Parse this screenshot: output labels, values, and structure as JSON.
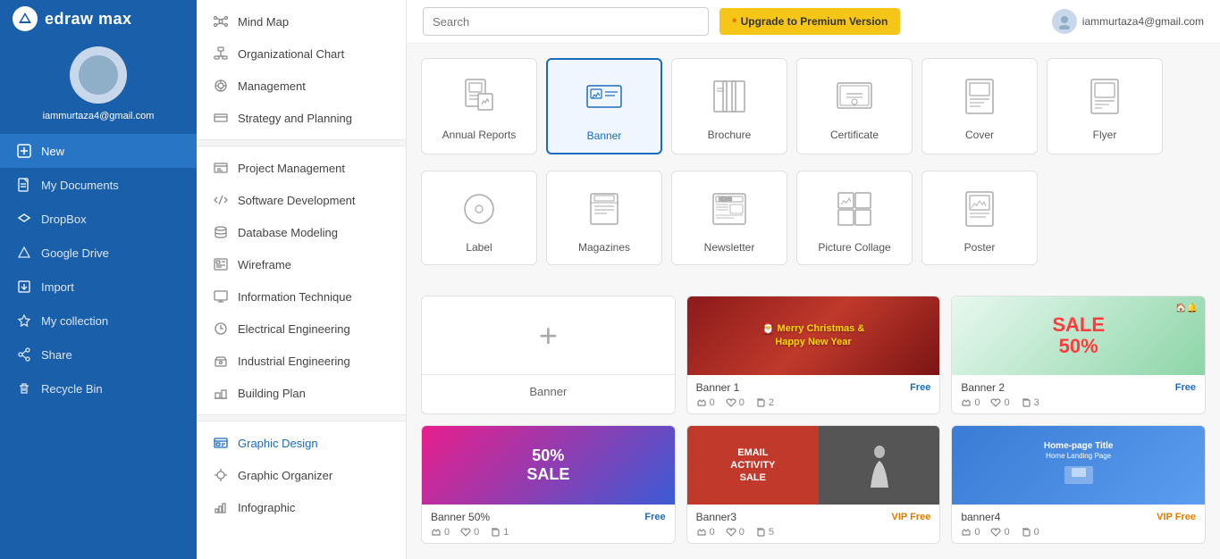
{
  "app": {
    "name": "edraw max"
  },
  "user": {
    "email": "iammurtaza4@gmail.com"
  },
  "topbar": {
    "search_placeholder": "Search",
    "upgrade_label": "Upgrade to Premium Version"
  },
  "sidebar_nav": [
    {
      "id": "new",
      "label": "New",
      "icon": "plus-square"
    },
    {
      "id": "my-documents",
      "label": "My Documents",
      "icon": "file"
    },
    {
      "id": "dropbox",
      "label": "DropBox",
      "icon": "dropbox"
    },
    {
      "id": "google-drive",
      "label": "Google Drive",
      "icon": "triangle"
    },
    {
      "id": "import",
      "label": "Import",
      "icon": "import"
    },
    {
      "id": "my-collection",
      "label": "My collection",
      "icon": "star"
    },
    {
      "id": "share",
      "label": "Share",
      "icon": "share"
    },
    {
      "id": "recycle-bin",
      "label": "Recycle Bin",
      "icon": "trash"
    }
  ],
  "categories": {
    "group1": [
      {
        "id": "mind-map",
        "label": "Mind Map"
      },
      {
        "id": "org-chart",
        "label": "Organizational Chart"
      },
      {
        "id": "management",
        "label": "Management"
      },
      {
        "id": "strategy",
        "label": "Strategy and Planning"
      }
    ],
    "group2": [
      {
        "id": "project-mgmt",
        "label": "Project Management"
      },
      {
        "id": "software-dev",
        "label": "Software Development"
      },
      {
        "id": "database",
        "label": "Database Modeling"
      },
      {
        "id": "wireframe",
        "label": "Wireframe"
      },
      {
        "id": "info-tech",
        "label": "Information Technique"
      },
      {
        "id": "electrical",
        "label": "Electrical Engineering"
      },
      {
        "id": "industrial",
        "label": "Industrial Engineering"
      },
      {
        "id": "building",
        "label": "Building Plan"
      }
    ],
    "group3": [
      {
        "id": "graphic-design",
        "label": "Graphic Design",
        "active": true
      },
      {
        "id": "graphic-organizer",
        "label": "Graphic Organizer"
      },
      {
        "id": "infographic",
        "label": "Infographic"
      }
    ]
  },
  "template_types": [
    {
      "id": "annual-reports",
      "label": "Annual Reports"
    },
    {
      "id": "banner",
      "label": "Banner",
      "selected": true
    },
    {
      "id": "brochure",
      "label": "Brochure"
    },
    {
      "id": "certificate",
      "label": "Certificate"
    },
    {
      "id": "cover",
      "label": "Cover"
    },
    {
      "id": "flyer",
      "label": "Flyer"
    },
    {
      "id": "label",
      "label": "Label"
    },
    {
      "id": "magazines",
      "label": "Magazines"
    },
    {
      "id": "newsletter",
      "label": "Newsletter"
    },
    {
      "id": "picture-collage",
      "label": "Picture Collage"
    },
    {
      "id": "poster",
      "label": "Poster"
    }
  ],
  "banners": [
    {
      "id": "new-banner",
      "type": "new",
      "label": "Banner"
    },
    {
      "id": "banner1",
      "title": "Banner 1",
      "badge": "Free",
      "badge_type": "free",
      "likes": "0",
      "hearts": "0",
      "copies": "2",
      "theme": "christmas"
    },
    {
      "id": "banner2",
      "title": "Banner 2",
      "badge": "Free",
      "badge_type": "free",
      "likes": "0",
      "hearts": "0",
      "copies": "3",
      "theme": "sale"
    },
    {
      "id": "banner3",
      "title": "Banner3",
      "badge": "VIP Free",
      "badge_type": "vip",
      "likes": "0",
      "hearts": "0",
      "copies": "5",
      "theme": "fashion"
    },
    {
      "id": "banner4",
      "title": "banner4",
      "badge": "VIP Free",
      "badge_type": "vip",
      "likes": "0",
      "hearts": "0",
      "copies": "0",
      "theme": "homepage"
    },
    {
      "id": "banner-fifty",
      "title": "Banner 50%",
      "badge": "Free",
      "badge_type": "free",
      "likes": "0",
      "hearts": "0",
      "copies": "1",
      "theme": "fifty"
    }
  ]
}
